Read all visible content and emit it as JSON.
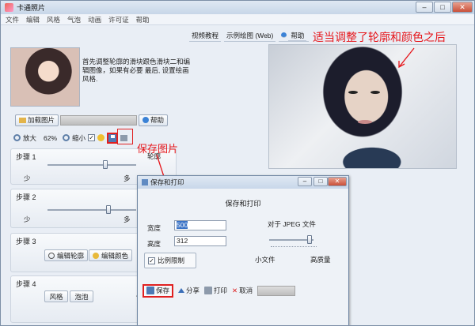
{
  "window": {
    "title": "卡通照片",
    "controls": {
      "min": "–",
      "max": "□",
      "close": "✕"
    }
  },
  "menu": [
    "文件",
    "编辑",
    "风格",
    "气泡",
    "动画",
    "许可证",
    "帮助"
  ],
  "intro_text": "首先调整轮廓的滑块跟色滑块二和编辑图像，如果有必要 最后, 设置绘画风格.",
  "load": {
    "load_button": "加载图片",
    "help_button": "帮助"
  },
  "zoom": {
    "zoom_in": "放大",
    "percent": "62%",
    "zoom_out": "缩小"
  },
  "steps": {
    "step1": {
      "title": "步骤 1",
      "less": "少",
      "more": "多",
      "name": "轮廓",
      "slider_level": 0.72
    },
    "step2": {
      "title": "步骤 2",
      "less": "少",
      "more": "多",
      "slider_level": 0.72
    },
    "step3": {
      "title": "步骤 3",
      "edit_outline": "编辑轮廓",
      "edit_color": "编辑颜色"
    },
    "step4": {
      "title": "步骤 4",
      "style": "风格",
      "bubble": "泡泡",
      "extra": "风"
    }
  },
  "tabs": [
    "视频教程",
    "示例绘图 (Web)",
    "帮助"
  ],
  "annotations": {
    "top": "适当调整了轮廓和颜色之后",
    "mid": "保存图片",
    "color": "#e6161b"
  },
  "dialog": {
    "title": "保存和打印",
    "controls": {
      "min": "–",
      "max": "□",
      "close": "✕"
    },
    "heading": "保存和打印",
    "width_label": "宽度",
    "width_value": "500",
    "height_label": "高度",
    "height_value": "312",
    "aspect_label": "比例限制",
    "jpeg_label": "对于 JPEG 文件",
    "small_file": "小文件",
    "high_quality": "高质量",
    "quality_level": 0.92,
    "buttons": {
      "save": "保存",
      "share": "分享",
      "print": "打印",
      "cancel": "取消"
    }
  }
}
